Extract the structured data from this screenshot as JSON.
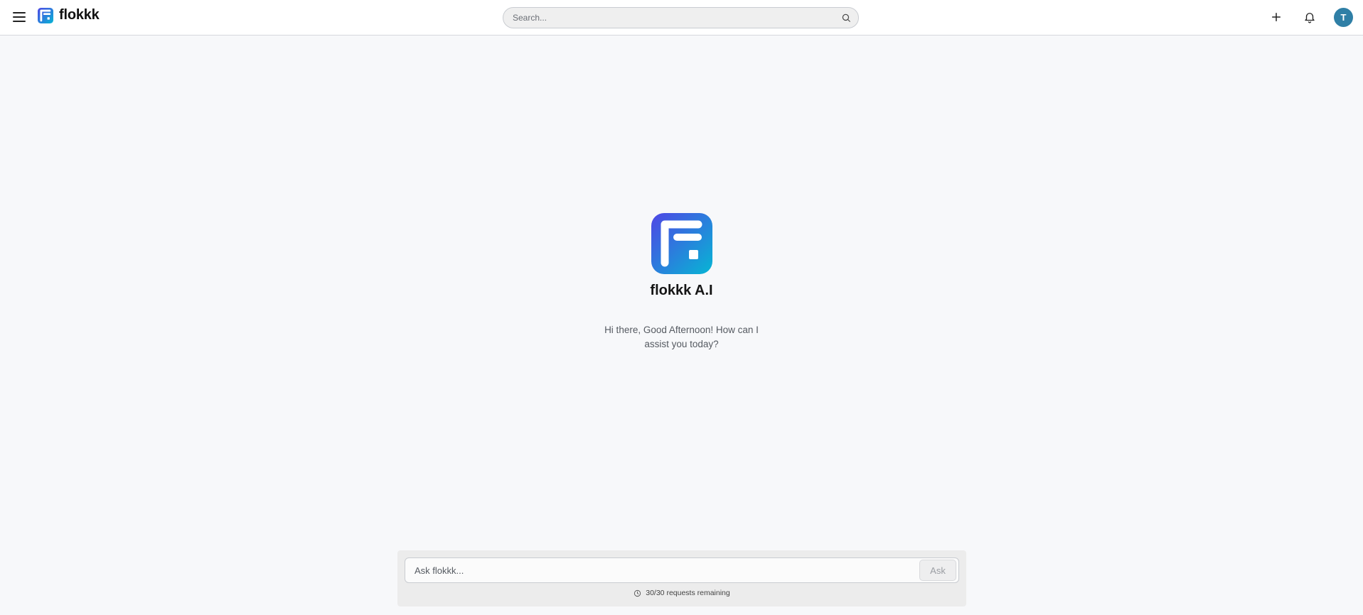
{
  "header": {
    "brand_name": "flokkk",
    "search_placeholder": "Search...",
    "avatar_initial": "T",
    "icons": [
      "menu-icon",
      "flokkk-logo",
      "search-icon",
      "plus-icon",
      "bell-icon"
    ]
  },
  "hero": {
    "title": "flokkk A.I",
    "greeting": "Hi there, Good Afternoon! How can I assist you today?"
  },
  "composer": {
    "placeholder": "Ask flokkk...",
    "ask_label": "Ask",
    "quota_text": "30/30 requests remaining"
  },
  "colors": {
    "brand_gradient_start": "#4f46e5",
    "brand_gradient_end": "#06b6d4",
    "avatar": "#2f7fa6",
    "background": "#f7f8fa"
  }
}
